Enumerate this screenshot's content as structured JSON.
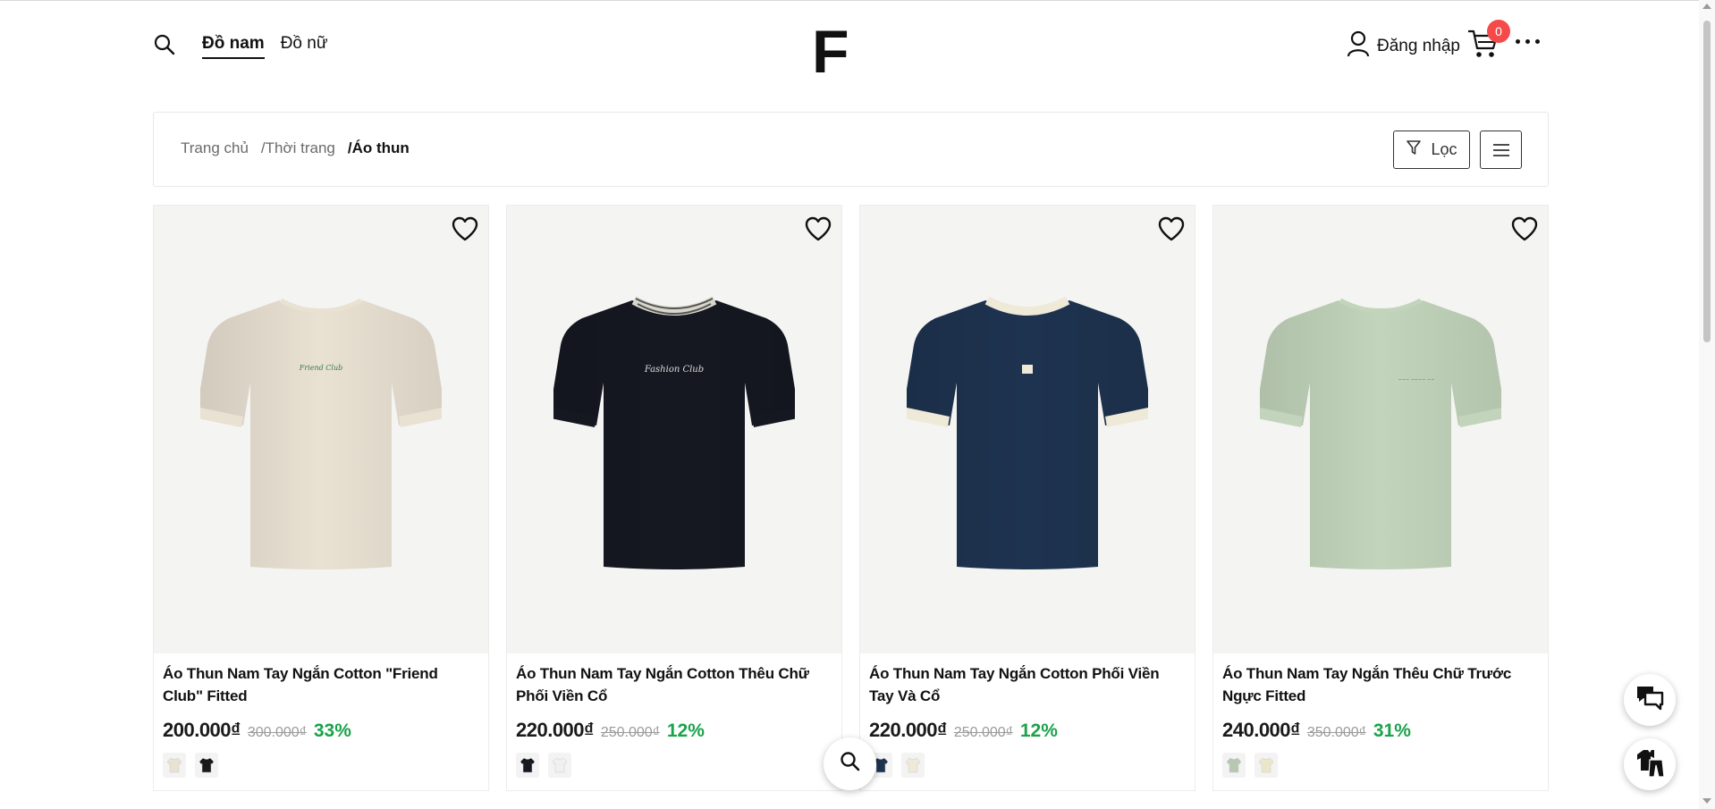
{
  "header": {
    "nav": [
      {
        "label": "Đồ nam",
        "active": true
      },
      {
        "label": "Đồ nữ",
        "active": false
      }
    ],
    "logo": "F",
    "login_label": "Đăng nhập",
    "cart_count": "0",
    "icons": {
      "search": "search-icon",
      "user": "user-icon",
      "cart": "cart-icon",
      "more": "more-dots-icon"
    }
  },
  "breadcrumb": {
    "items": [
      "Trang chủ",
      "/Thời trang",
      "/Áo thun"
    ]
  },
  "toolbar": {
    "filter_label": "Lọc",
    "view_icon": "menu-lines-icon"
  },
  "products": [
    {
      "name": "Áo Thun Nam Tay Ngắn Cotton \"Friend Club\" Fitted",
      "price": "200.000₫",
      "old_price": "300.000₫",
      "discount": "33%",
      "shirt_color": "#e9e1d2",
      "collar_color": "#e9e1d2",
      "swatches": [
        "#e9e1d2",
        "#1a1a1a"
      ]
    },
    {
      "name": "Áo Thun Nam Tay Ngắn Cotton Thêu Chữ Phối Viền Cổ",
      "price": "220.000₫",
      "old_price": "250.000₫",
      "discount": "12%",
      "shirt_color": "#151821",
      "collar_color": "#d9d6cc",
      "swatches": [
        "#151821",
        "#f0f0ee"
      ]
    },
    {
      "name": "Áo Thun Nam Tay Ngắn Cotton Phối Viền Tay Và Cổ",
      "price": "220.000₫",
      "old_price": "250.000₫",
      "discount": "12%",
      "shirt_color": "#1e3350",
      "collar_color": "#efe9d8",
      "swatches": [
        "#1e3350",
        "#efe9d8"
      ]
    },
    {
      "name": "Áo Thun Nam Tay Ngắn Thêu Chữ Trước Ngực Fitted",
      "price": "240.000₫",
      "old_price": "350.000₫",
      "discount": "31%",
      "shirt_color": "#c2d4bb",
      "collar_color": "#c2d4bb",
      "swatches": [
        "#b7c7b2",
        "#ece6c9"
      ]
    }
  ],
  "floating": {
    "search_icon": "search-icon",
    "chat_icon": "chat-bubbles-icon",
    "outfit_icon": "outfit-icon"
  },
  "colors": {
    "discount": "#1aa34a",
    "badge": "#f44a4a",
    "card_bg": "#f4f4f2"
  }
}
